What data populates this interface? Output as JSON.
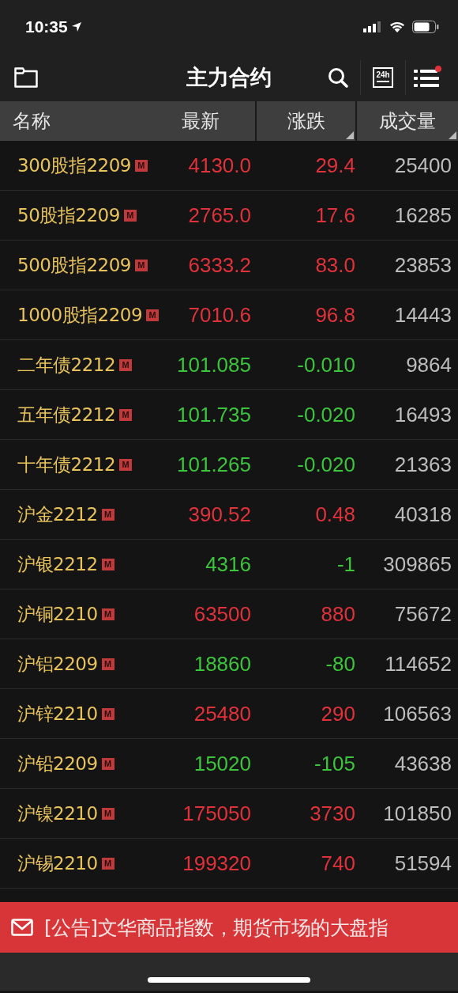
{
  "status_bar": {
    "time": "10:35"
  },
  "header": {
    "title": "主力合约",
    "clock_label": "24h",
    "has_notification": true
  },
  "table": {
    "columns": [
      {
        "label": "名称",
        "sortable": false
      },
      {
        "label": "最新",
        "sortable": false
      },
      {
        "label": "涨跌",
        "sortable": true
      },
      {
        "label": "成交量",
        "sortable": true
      }
    ],
    "rows": [
      {
        "name": "300股指2209",
        "badge": "M",
        "price": "4130.0",
        "change": "29.4",
        "volume": "25400",
        "up": true
      },
      {
        "name": "50股指2209",
        "badge": "M",
        "price": "2765.0",
        "change": "17.6",
        "volume": "16285",
        "up": true
      },
      {
        "name": "500股指2209",
        "badge": "M",
        "price": "6333.2",
        "change": "83.0",
        "volume": "23853",
        "up": true
      },
      {
        "name": "1000股指2209",
        "badge": "M",
        "price": "7010.6",
        "change": "96.8",
        "volume": "14443",
        "up": true
      },
      {
        "name": "二年债2212",
        "badge": "M",
        "price": "101.085",
        "change": "-0.010",
        "volume": "9864",
        "up": false
      },
      {
        "name": "五年债2212",
        "badge": "M",
        "price": "101.735",
        "change": "-0.020",
        "volume": "16493",
        "up": false
      },
      {
        "name": "十年债2212",
        "badge": "M",
        "price": "101.265",
        "change": "-0.020",
        "volume": "21363",
        "up": false
      },
      {
        "name": "沪金2212",
        "badge": "M",
        "price": "390.52",
        "change": "0.48",
        "volume": "40318",
        "up": true
      },
      {
        "name": "沪银2212",
        "badge": "M",
        "price": "4316",
        "change": "-1",
        "volume": "309865",
        "up": false
      },
      {
        "name": "沪铜2210",
        "badge": "M",
        "price": "63500",
        "change": "880",
        "volume": "75672",
        "up": true
      },
      {
        "name": "沪铝2209",
        "badge": "M",
        "price": "18860",
        "change": "-80",
        "volume": "114652",
        "up": false
      },
      {
        "name": "沪锌2210",
        "badge": "M",
        "price": "25480",
        "change": "290",
        "volume": "106563",
        "up": true
      },
      {
        "name": "沪铅2209",
        "badge": "M",
        "price": "15020",
        "change": "-105",
        "volume": "43638",
        "up": false
      },
      {
        "name": "沪镍2210",
        "badge": "M",
        "price": "175050",
        "change": "3730",
        "volume": "101850",
        "up": true
      },
      {
        "name": "沪锡2210",
        "badge": "M",
        "price": "199320",
        "change": "740",
        "volume": "51594",
        "up": true
      }
    ]
  },
  "notice": {
    "text": "[公告]文华商品指数，期货市场的大盘指"
  }
}
